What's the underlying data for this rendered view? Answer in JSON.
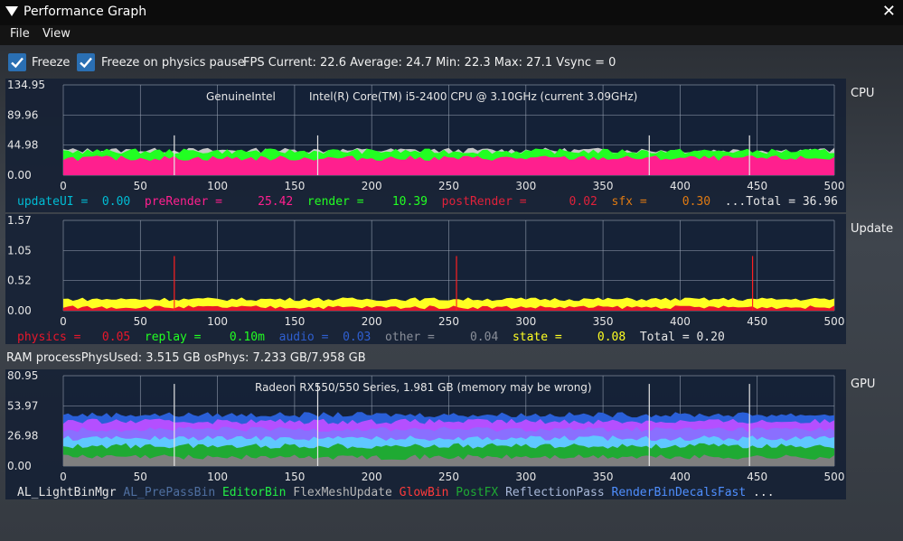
{
  "window": {
    "title": "Performance Graph"
  },
  "menu": {
    "file": "File",
    "view": "View"
  },
  "controls": {
    "freeze_label": "Freeze",
    "freeze_checked": true,
    "freeze_physics_label": "Freeze on physics pause",
    "freeze_physics_checked": true,
    "fps_text": "FPS  Current: 22.6  Average: 24.7  Min: 22.3  Max: 27.1 Vsync = 0"
  },
  "ram_text": "RAM  processPhysUsed: 3.515 GB  osPhys: 7.233 GB/7.958 GB",
  "icons": {
    "collapse": "triangle-down-icon",
    "close": "close-icon",
    "check": "check-icon"
  },
  "chart_data": [
    {
      "type": "area",
      "panel_label": "CPU",
      "header": [
        "GenuineIntel",
        "Intel(R) Core(TM) i5-2400 CPU @ 3.10GHz (current 3.09GHz)"
      ],
      "xlim": [
        0,
        500
      ],
      "x_ticks": [
        "0",
        "50",
        "100",
        "150",
        "200",
        "250",
        "300",
        "350",
        "400",
        "450",
        "500"
      ],
      "ylim": [
        0,
        134.95
      ],
      "y_ticks": [
        "134.95",
        "89.96",
        "44.98",
        "0.00"
      ],
      "grid": true,
      "series": [
        {
          "name": "updateUI",
          "value": "0.00",
          "color": "#00bcd4"
        },
        {
          "name": "preRender",
          "value": "25.42",
          "color": "#ff1f8e"
        },
        {
          "name": "render",
          "value": "10.39",
          "color": "#22ff22"
        },
        {
          "name": "postRender",
          "value": "0.02",
          "color": "#e0213a"
        },
        {
          "name": "sfx",
          "value": "0.30",
          "color": "#e07a12"
        }
      ],
      "total": "...Total = 36.96",
      "stack_levels": [
        25.4,
        35.8,
        37.2
      ]
    },
    {
      "type": "area",
      "panel_label": "Update",
      "xlim": [
        0,
        500
      ],
      "x_ticks": [
        "0",
        "50",
        "100",
        "150",
        "200",
        "250",
        "300",
        "350",
        "400",
        "450",
        "500"
      ],
      "ylim": [
        0,
        1.57
      ],
      "y_ticks": [
        "1.57",
        "1.05",
        "0.52",
        "0.00"
      ],
      "grid": true,
      "series": [
        {
          "name": "physics",
          "value": "0.05",
          "color": "#e8172b"
        },
        {
          "name": "replay",
          "value": "0.10m",
          "color": "#22ff22"
        },
        {
          "name": "audio",
          "value": "0.03",
          "color": "#2f5fd0"
        },
        {
          "name": "other",
          "value": "0.04",
          "color": "#8a8f99"
        },
        {
          "name": "state",
          "value": "0.08",
          "color": "#ffff22"
        }
      ],
      "total": "Total = 0.20",
      "stack_levels": [
        0.06,
        0.2
      ]
    },
    {
      "type": "area",
      "panel_label": "GPU",
      "header": [
        "Radeon RX550/550 Series, 1.981 GB (memory may be wrong)"
      ],
      "xlim": [
        0,
        500
      ],
      "x_ticks": [
        "0",
        "50",
        "100",
        "150",
        "200",
        "250",
        "300",
        "350",
        "400",
        "450",
        "500"
      ],
      "ylim": [
        0,
        80.95
      ],
      "y_ticks": [
        "80.95",
        "53.97",
        "26.98",
        "0.00"
      ],
      "grid": true,
      "series": [
        {
          "name": "AL_LightBinMgr",
          "color": "#e6e6e6"
        },
        {
          "name": "AL_PrePassBin",
          "color": "#4f6fa0"
        },
        {
          "name": "EditorBin",
          "color": "#22ee44"
        },
        {
          "name": "FlexMeshUpdate",
          "color": "#b8b8b8"
        },
        {
          "name": "GlowBin",
          "color": "#ff3a3a"
        },
        {
          "name": "PostFX",
          "color": "#1faa33"
        },
        {
          "name": "ReflectionPass",
          "color": "#a8b8d8"
        },
        {
          "name": "RenderBinDecalsFast",
          "color": "#4f8fff"
        }
      ],
      "more": " ...",
      "stack_levels": [
        8,
        18,
        25,
        33,
        40,
        46
      ]
    }
  ]
}
